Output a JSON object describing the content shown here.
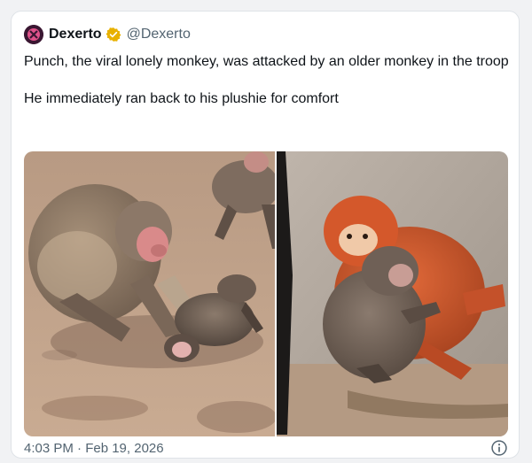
{
  "author": {
    "display_name": "Dexerto",
    "handle": "@Dexerto",
    "verified": true,
    "verified_color": "#e8b100",
    "avatar_icon": "dexerto-logo-icon"
  },
  "tweet": {
    "text_paragraphs": [
      "Punch, the viral lonely monkey, was attacked by an older monkey in the troop",
      "He immediately ran back to his plushie for comfort"
    ]
  },
  "media": {
    "images": [
      {
        "subject": "older monkey pinning baby monkey on ground"
      },
      {
        "subject": "baby monkey hugging orange orangutan plushie"
      }
    ]
  },
  "footer": {
    "timestamp": "4:03 PM · Feb 19, 2026",
    "info_icon": "info-icon"
  },
  "colors": {
    "text_primary": "#0f1419",
    "text_secondary": "#536471",
    "card_border": "#dfe3e7"
  }
}
